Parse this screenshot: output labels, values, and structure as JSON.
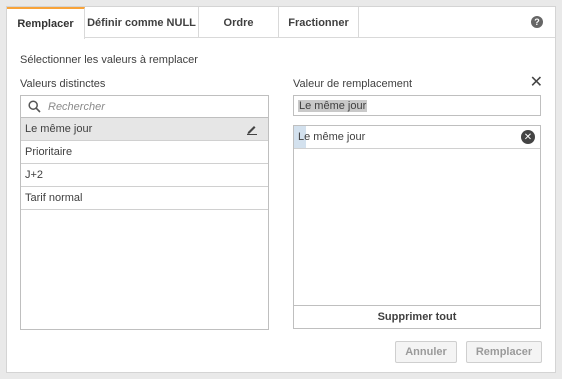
{
  "tabs": [
    {
      "label": "Remplacer"
    },
    {
      "label": "Définir comme NULL"
    },
    {
      "label": "Ordre"
    },
    {
      "label": "Fractionner"
    }
  ],
  "help_glyph": "?",
  "subtitle": "Sélectionner les valeurs à remplacer",
  "left": {
    "label": "Valeurs distinctes",
    "search_placeholder": "Rechercher",
    "items": [
      {
        "label": "Le même jour",
        "selected": true
      },
      {
        "label": "Prioritaire"
      },
      {
        "label": "J+2"
      },
      {
        "label": "Tarif normal"
      }
    ]
  },
  "right": {
    "label": "Valeur de remplacement",
    "input_value": "Le même jour",
    "items": [
      {
        "label": "Le même jour"
      }
    ],
    "delete_all_label": "Supprimer tout"
  },
  "footer": {
    "cancel_label": "Annuler",
    "replace_label": "Remplacer"
  },
  "colors": {
    "accent": "#f8a33a",
    "selected_row": "#e6e6e6",
    "value_highlight": "#d3e1ee"
  }
}
